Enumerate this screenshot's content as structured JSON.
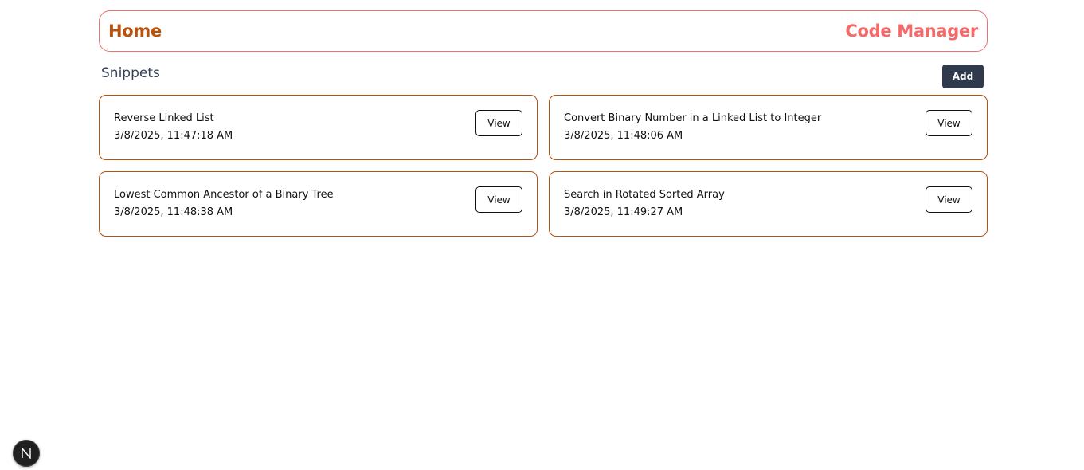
{
  "header": {
    "home_label": "Home",
    "app_title": "Code Manager"
  },
  "section": {
    "title": "Snippets",
    "add_label": "Add"
  },
  "snippets": [
    {
      "title": "Reverse Linked List",
      "date": "3/8/2025, 11:47:18 AM",
      "action_label": "View"
    },
    {
      "title": "Convert Binary Number in a Linked List to Integer",
      "date": "3/8/2025, 11:48:06 AM",
      "action_label": "View"
    },
    {
      "title": "Lowest Common Ancestor of a Binary Tree",
      "date": "3/8/2025, 11:48:38 AM",
      "action_label": "View"
    },
    {
      "title": "Search in Rotated Sorted Array",
      "date": "3/8/2025, 11:49:27 AM",
      "action_label": "View"
    }
  ],
  "dev_badge": {
    "icon": "nextjs-n-icon"
  },
  "colors": {
    "home": "#b5530f",
    "title": "#f26a6a",
    "header_border": "#f07070",
    "card_border": "#b5530f",
    "add_button_bg": "#2f3a4c"
  }
}
